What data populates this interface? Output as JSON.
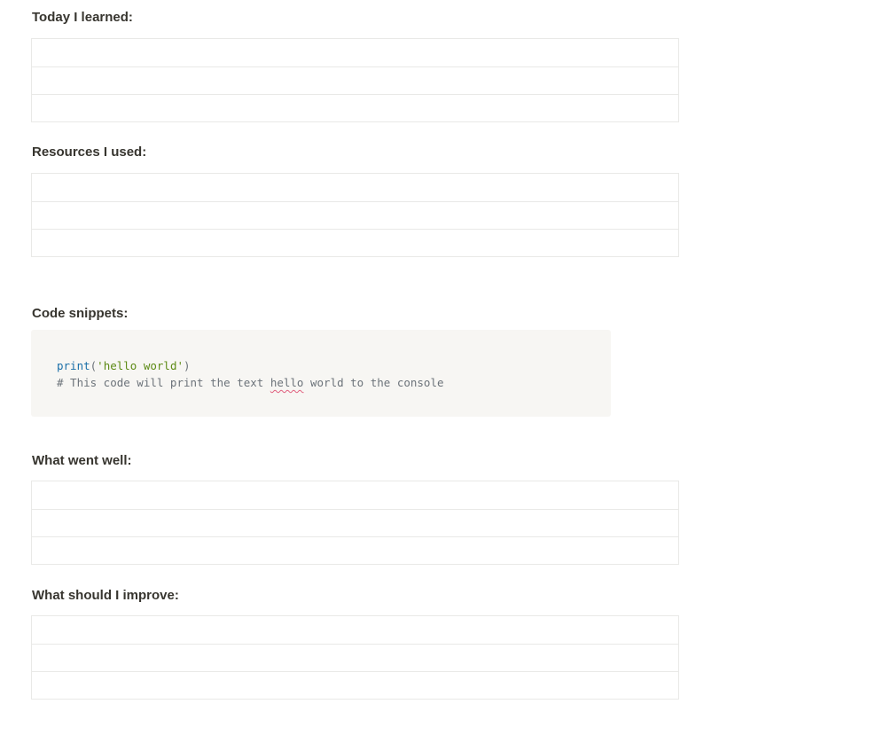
{
  "sections": {
    "today_learned": {
      "title": "Today I learned:",
      "rows": [
        "",
        "",
        ""
      ]
    },
    "resources": {
      "title": "Resources I used:",
      "rows": [
        "",
        "",
        ""
      ]
    },
    "code": {
      "title": "Code snippets:",
      "line1": {
        "fn": "print",
        "open": "(",
        "string": "'hello world'",
        "close": ")"
      },
      "line2": {
        "before": "# This code will print the text ",
        "flagged": "hello",
        "after": " world to the console"
      }
    },
    "went_well": {
      "title": "What went well:",
      "rows": [
        "",
        "",
        ""
      ]
    },
    "improve": {
      "title": "What should I improve:",
      "rows": [
        "",
        "",
        ""
      ]
    }
  },
  "colors": {
    "text": "#37352f",
    "table_border": "#e9e9e7",
    "code_background": "#f7f6f3",
    "code_function": "#1a6fa8",
    "code_string": "#5c8a14",
    "code_comment": "#6c737a",
    "spellcheck_underline": "#e0607e"
  }
}
